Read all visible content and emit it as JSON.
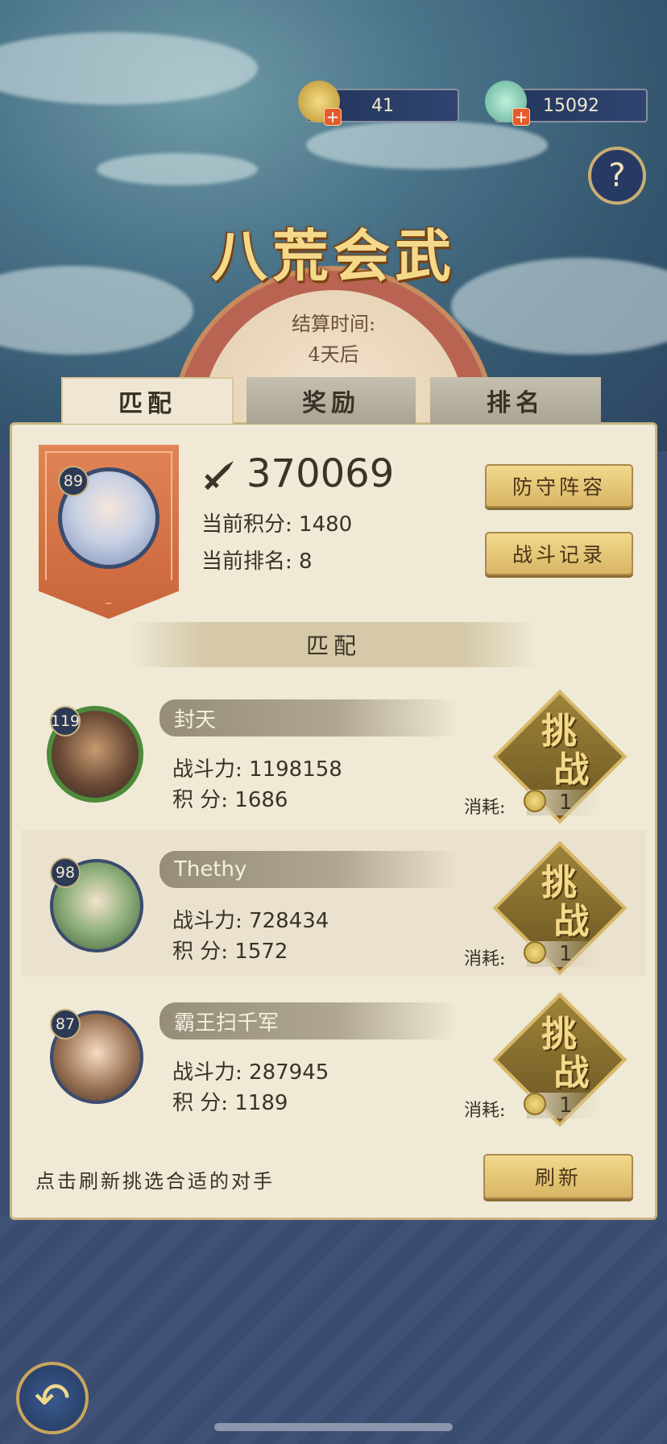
{
  "currencies": [
    {
      "name": "dragon-token",
      "value": "41"
    },
    {
      "name": "jade-shell",
      "value": "15092"
    }
  ],
  "help_label": "?",
  "title": "八荒会武",
  "settlement": {
    "label": "结算时间:",
    "value": "4天后"
  },
  "tabs": [
    {
      "label": "匹配",
      "active": true
    },
    {
      "label": "奖励",
      "active": false
    },
    {
      "label": "排名",
      "active": false
    }
  ],
  "player": {
    "level": "89",
    "power": "370069",
    "score_label": "当前积分:",
    "score": "1480",
    "rank_label": "当前排名:",
    "rank": "8"
  },
  "buttons": {
    "defense": "防守阵容",
    "record": "战斗记录",
    "refresh": "刷新"
  },
  "match_heading": "匹配",
  "opponents": [
    {
      "level": "119",
      "name": "封天",
      "power_label": "战斗力:",
      "power": "1198158",
      "score_label": "积 分:",
      "score": "1686",
      "challenge": [
        "挑",
        "战"
      ],
      "cost_label": "消耗:",
      "cost": "1"
    },
    {
      "level": "98",
      "name": "Thethy",
      "power_label": "战斗力:",
      "power": "728434",
      "score_label": "积 分:",
      "score": "1572",
      "challenge": [
        "挑",
        "战"
      ],
      "cost_label": "消耗:",
      "cost": "1"
    },
    {
      "level": "87",
      "name": "霸王扫千军",
      "power_label": "战斗力:",
      "power": "287945",
      "score_label": "积 分:",
      "score": "1189",
      "challenge": [
        "挑",
        "战"
      ],
      "cost_label": "消耗:",
      "cost": "1"
    }
  ],
  "hint": "点击刷新挑选合适的对手",
  "colors": {
    "panel": "#efe9d6",
    "gold": "#f4d98b",
    "banner": "#d9754a",
    "navy": "#3c4e74"
  }
}
